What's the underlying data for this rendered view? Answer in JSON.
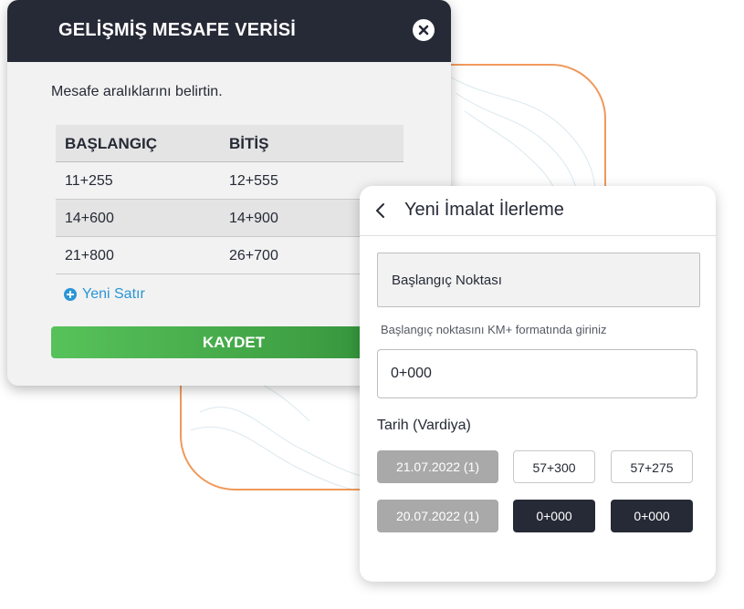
{
  "modal": {
    "title": "GELİŞMİŞ MESAFE VERİSİ",
    "instruction": "Mesafe aralıklarını belirtin.",
    "table": {
      "headers": [
        "BAŞLANGIÇ",
        "BİTİŞ"
      ],
      "rows": [
        [
          "11+255",
          "12+555"
        ],
        [
          "14+600",
          "14+900"
        ],
        [
          "21+800",
          "26+700"
        ]
      ]
    },
    "new_row_label": "Yeni Satır",
    "save_label": "KAYDET"
  },
  "card": {
    "title": "Yeni İmalat İlerleme",
    "start_label": "Başlangıç Noktası",
    "hint": "Başlangıç noktasını KM+ formatında giriniz",
    "input_value": "0+000",
    "date_label": "Tarih (Vardiya)",
    "entries": [
      {
        "date": "21.07.2022 (1)",
        "start": "57+300",
        "end": "57+275"
      },
      {
        "date": "20.07.2022 (1)",
        "start": "0+000",
        "end": "0+000"
      }
    ]
  },
  "colors": {
    "dark": "#262a36",
    "accent_green": "#3ea043",
    "link_blue": "#2a95d6",
    "frame_orange": "#f0995b"
  }
}
